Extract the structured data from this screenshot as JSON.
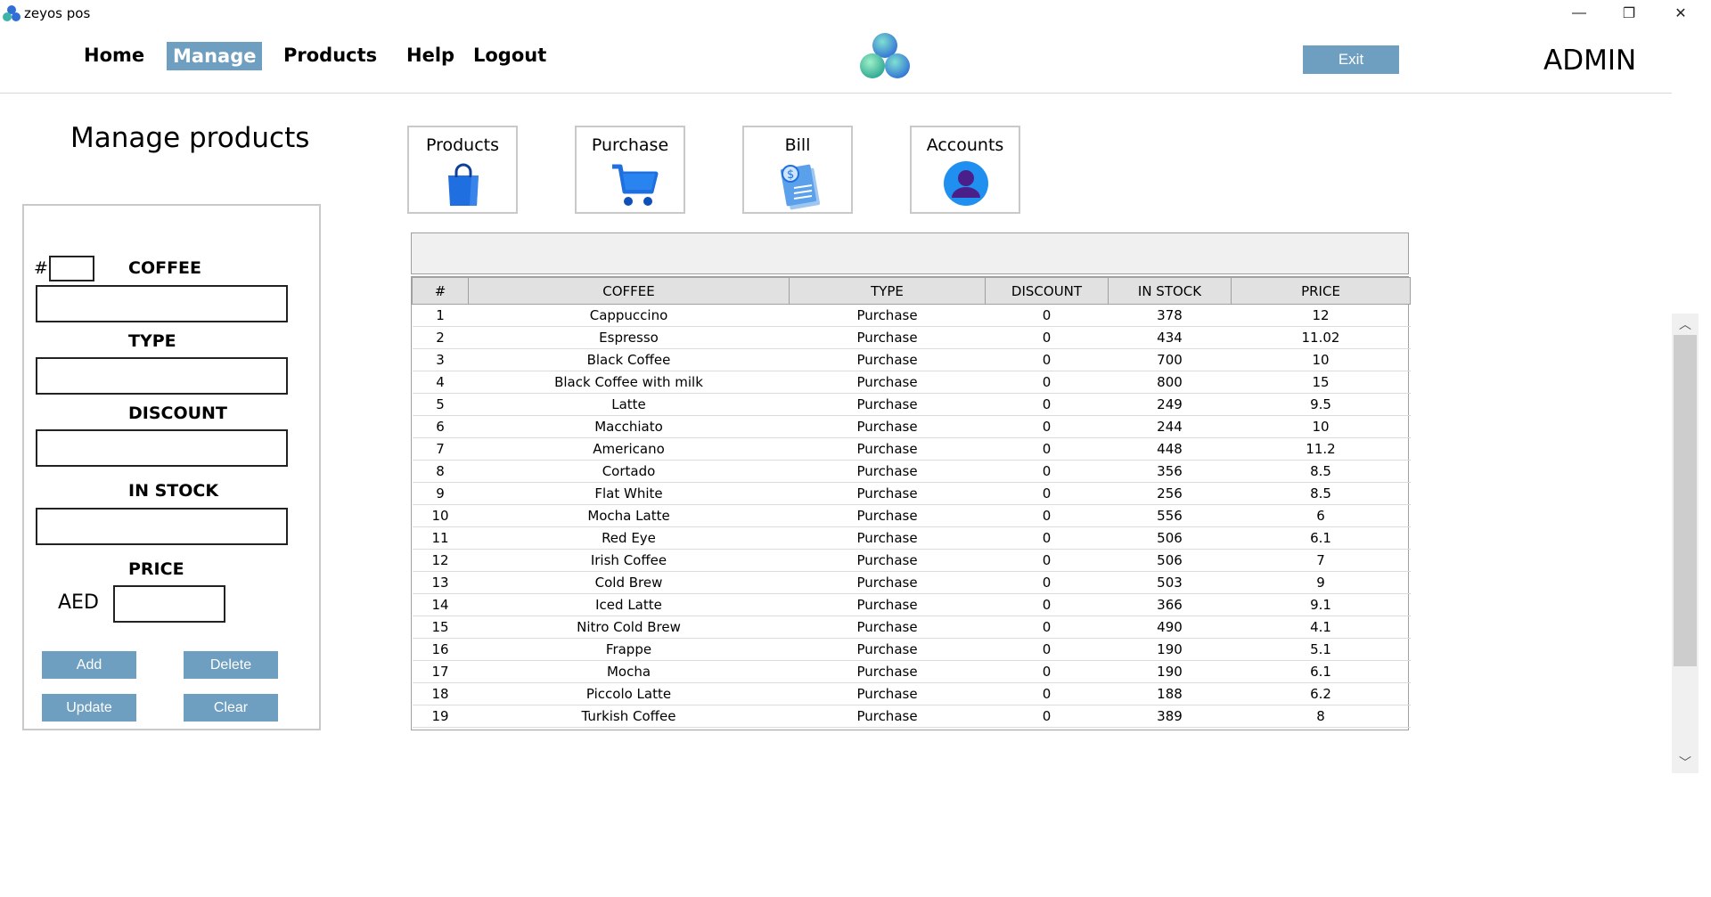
{
  "window": {
    "title": "zeyos pos",
    "minimize_glyph": "—",
    "maximize_glyph": "❐",
    "close_glyph": "✕"
  },
  "nav": {
    "home": "Home",
    "manage": "Manage",
    "products": "Products",
    "help": "Help",
    "logout": "Logout",
    "exit": "Exit",
    "admin": "ADMIN"
  },
  "form": {
    "title": "Manage products",
    "hash_label": "#",
    "coffee_label": "COFFEE",
    "type_label": "TYPE",
    "discount_label": "DISCOUNT",
    "instock_label": "IN STOCK",
    "price_label": "PRICE",
    "currency_label": "AED",
    "buttons": {
      "add": "Add",
      "delete": "Delete",
      "update": "Update",
      "clear": "Clear"
    }
  },
  "tiles": [
    {
      "label": "Products",
      "icon": "shopping-bag-icon"
    },
    {
      "label": "Purchase",
      "icon": "shopping-cart-icon"
    },
    {
      "label": "Bill",
      "icon": "bill-icon"
    },
    {
      "label": "Accounts",
      "icon": "user-account-icon"
    }
  ],
  "table": {
    "headers": [
      "#",
      "COFFEE",
      "TYPE",
      "DISCOUNT",
      "IN STOCK",
      "PRICE"
    ],
    "rows": [
      [
        "1",
        "Cappuccino",
        "Purchase",
        "0",
        "378",
        "12"
      ],
      [
        "2",
        "Espresso",
        "Purchase",
        "0",
        "434",
        "11.02"
      ],
      [
        "3",
        "Black Coffee",
        "Purchase",
        "0",
        "700",
        "10"
      ],
      [
        "4",
        "Black Coffee with milk",
        "Purchase",
        "0",
        "800",
        "15"
      ],
      [
        "5",
        "Latte",
        "Purchase",
        "0",
        "249",
        "9.5"
      ],
      [
        "6",
        "Macchiato",
        "Purchase",
        "0",
        "244",
        "10"
      ],
      [
        "7",
        "Americano",
        "Purchase",
        "0",
        "448",
        "11.2"
      ],
      [
        "8",
        "Cortado",
        "Purchase",
        "0",
        "356",
        "8.5"
      ],
      [
        "9",
        "Flat White",
        "Purchase",
        "0",
        "256",
        "8.5"
      ],
      [
        "10",
        "Mocha Latte",
        "Purchase",
        "0",
        "556",
        "6"
      ],
      [
        "11",
        "Red Eye",
        "Purchase",
        "0",
        "506",
        "6.1"
      ],
      [
        "12",
        "Irish Coffee",
        "Purchase",
        "0",
        "506",
        "7"
      ],
      [
        "13",
        "Cold Brew",
        "Purchase",
        "0",
        "503",
        "9"
      ],
      [
        "14",
        "Iced Latte",
        "Purchase",
        "0",
        "366",
        "9.1"
      ],
      [
        "15",
        "Nitro Cold Brew",
        "Purchase",
        "0",
        "490",
        "4.1"
      ],
      [
        "16",
        "Frappe",
        "Purchase",
        "0",
        "190",
        "5.1"
      ],
      [
        "17",
        "Mocha",
        "Purchase",
        "0",
        "190",
        "6.1"
      ],
      [
        "18",
        "Piccolo Latte",
        "Purchase",
        "0",
        "188",
        "6.2"
      ],
      [
        "19",
        "Turkish Coffee",
        "Purchase",
        "0",
        "389",
        "8"
      ]
    ]
  },
  "colors": {
    "accent_button": "#6e9ec0",
    "logo_teal": "#3fb3a8",
    "logo_blue": "#2f6fd6"
  }
}
